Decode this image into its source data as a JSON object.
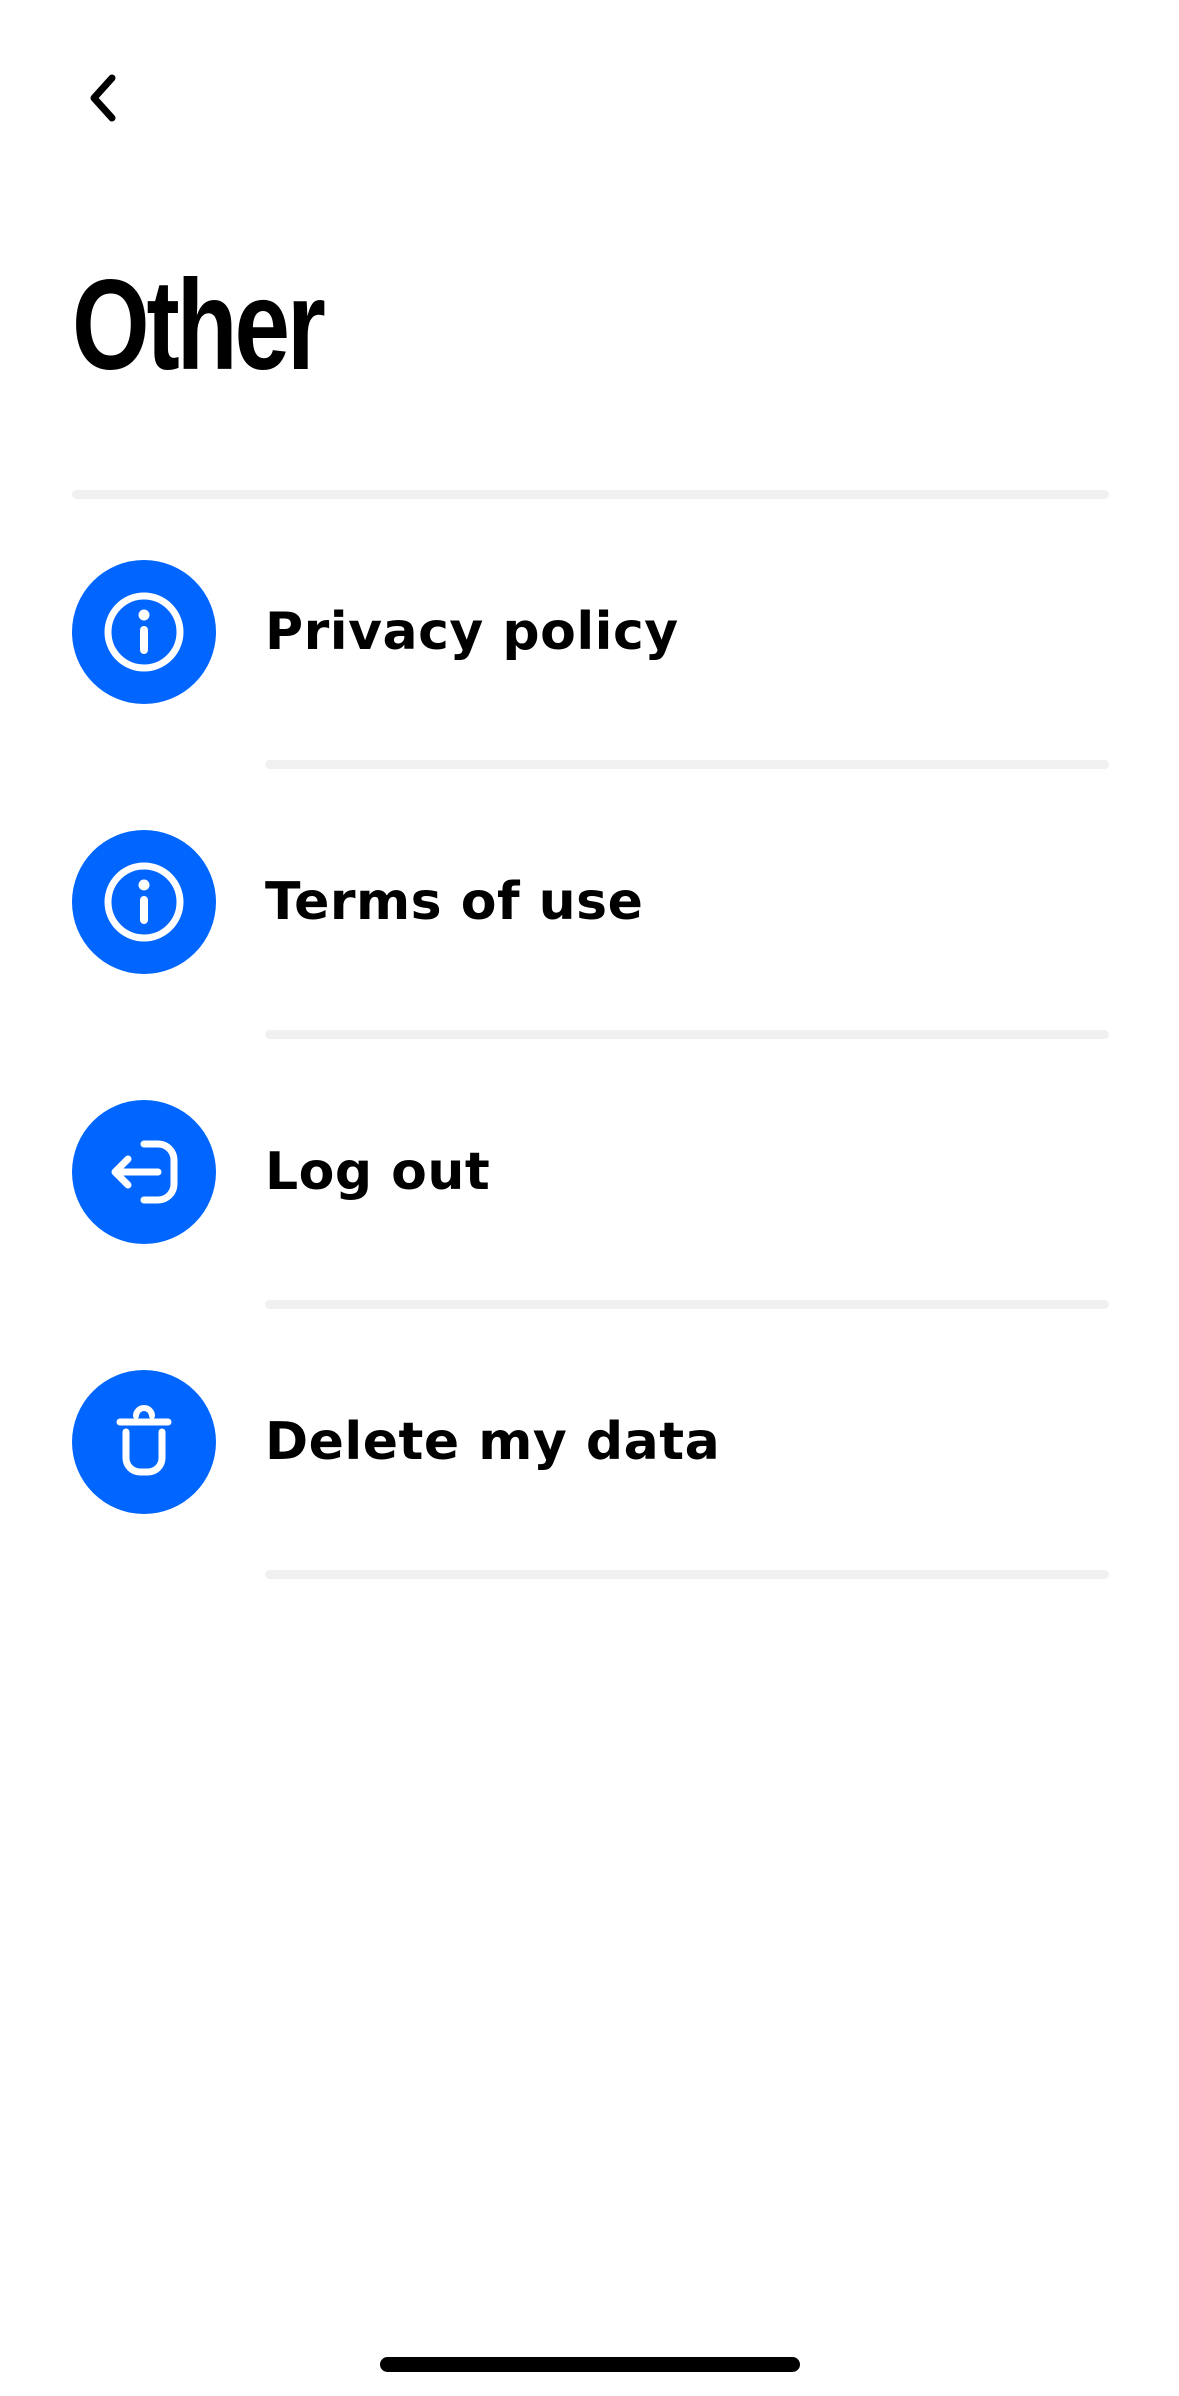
{
  "header": {
    "back_icon": "chevron-left-icon",
    "title": "Other"
  },
  "menu": {
    "items": [
      {
        "label": "Privacy policy",
        "icon": "info-icon"
      },
      {
        "label": "Terms of use",
        "icon": "info-icon"
      },
      {
        "label": "Log out",
        "icon": "logout-icon"
      },
      {
        "label": "Delete my data",
        "icon": "trash-icon"
      }
    ]
  },
  "colors": {
    "accent": "#0066ff",
    "divider": "#f0f0f0",
    "text": "#000000",
    "background": "#ffffff"
  }
}
